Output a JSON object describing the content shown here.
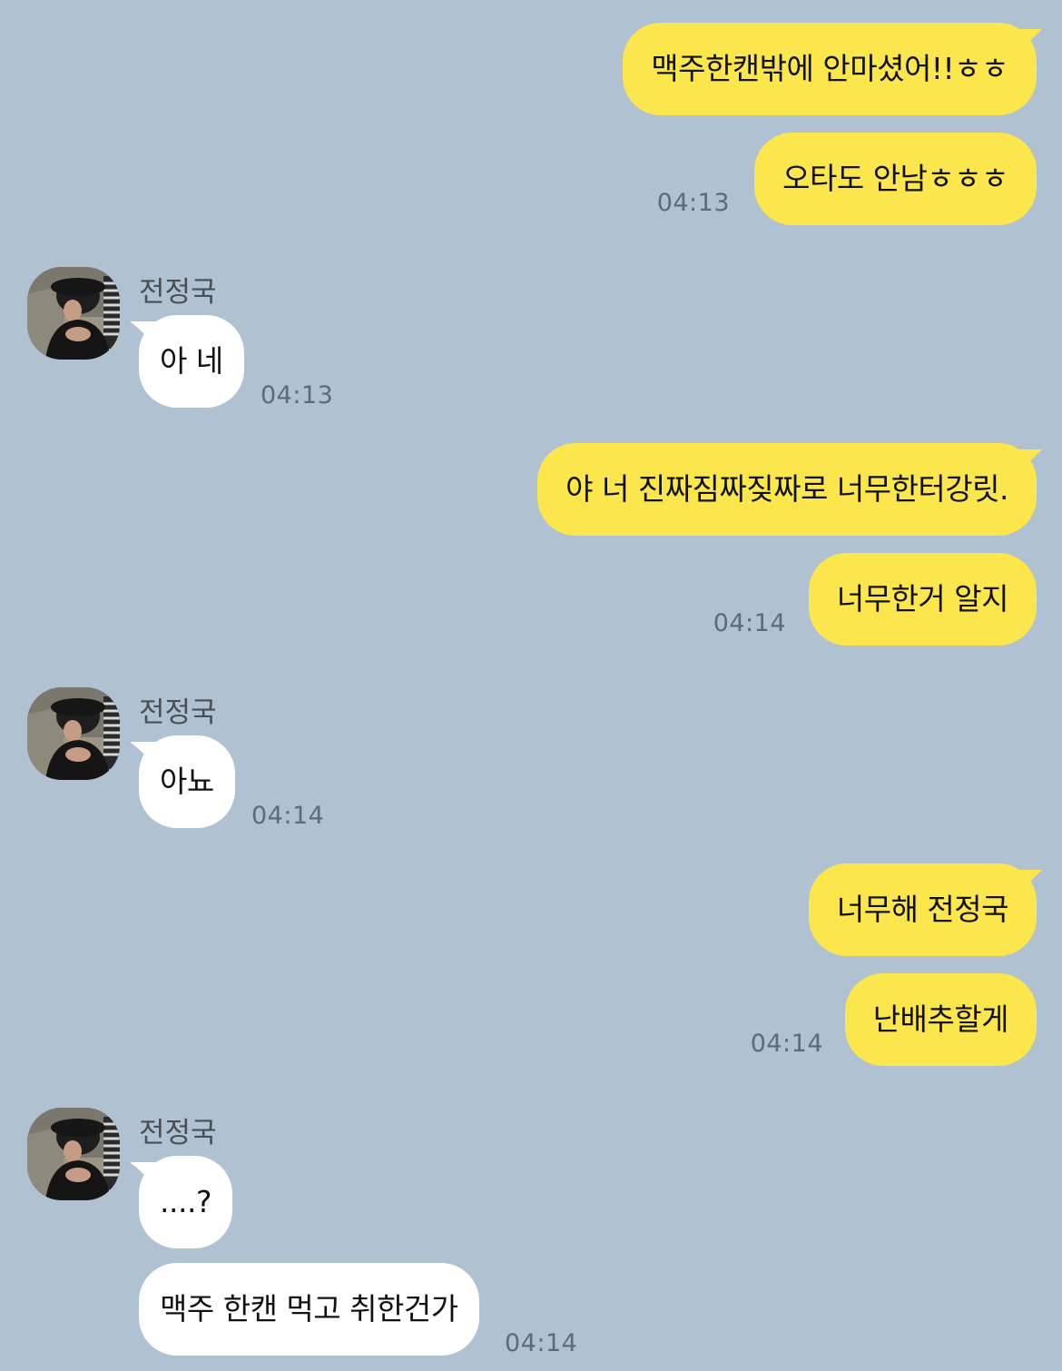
{
  "colors": {
    "background": "#b0c1d1",
    "my_bubble": "#fbe64d",
    "their_bubble": "#ffffff",
    "timestamp": "#5d6b78",
    "sender_name": "#4a4f55"
  },
  "contact": {
    "name": "전정국",
    "avatar_icon": "profile-photo-avatar"
  },
  "messages": [
    {
      "from": "me",
      "text": "맥주한캔밖에 안마셨어!!ㅎㅎ"
    },
    {
      "from": "me",
      "text": "오타도 안남ㅎㅎㅎ",
      "time": "04:13"
    },
    {
      "from": "them",
      "sender": "전정국",
      "text": "아 네",
      "time": "04:13"
    },
    {
      "from": "me",
      "text": "야 너 진짜짐짜짖짜로 너무한터강릿."
    },
    {
      "from": "me",
      "text": "너무한거 알지",
      "time": "04:14"
    },
    {
      "from": "them",
      "sender": "전정국",
      "text": "아뇨",
      "time": "04:14"
    },
    {
      "from": "me",
      "text": "너무해 전정국"
    },
    {
      "from": "me",
      "text": "난배추할게",
      "time": "04:14"
    },
    {
      "from": "them",
      "sender": "전정국",
      "text": "....?"
    },
    {
      "from": "them",
      "text": "맥주 한캔 먹고 취한건가",
      "time": "04:14"
    }
  ]
}
